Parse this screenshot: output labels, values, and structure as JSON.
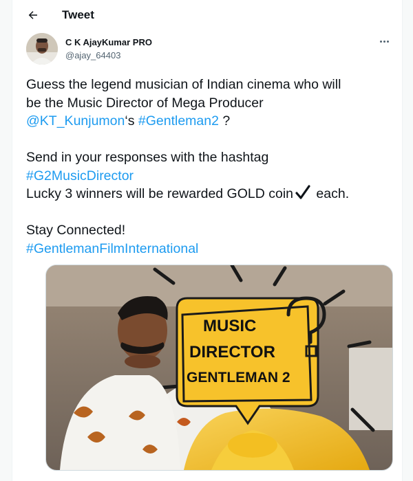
{
  "header": {
    "title": "Tweet",
    "back_icon": "arrow-left-icon"
  },
  "author": {
    "name": "C K AjayKumar PRO",
    "handle": "@ajay_64403",
    "more_icon": "more-horizontal-icon"
  },
  "tweet": {
    "line1": "Guess the legend musician of Indian cinema who will",
    "line2": "be the Music Director of Mega Producer",
    "mention": "@KT_Kunjumon",
    "possessive": "‘s ",
    "hashtag_gentleman2": "#Gentleman2",
    "question_mark": " ?",
    "line4": "Send in your responses with the hashtag",
    "hashtag_g2": "#G2MusicDirector",
    "line6_pre": "Lucky 3 winners will be rewarded GOLD coin",
    "line6_post": " each.",
    "line8": "Stay Connected!",
    "hashtag_international": "#GentlemanFilmInternational"
  },
  "media": {
    "badge_line1": "MUSIC",
    "badge_line2": "DIRECTOR",
    "badge_line3": "GENTLEMAN 2"
  },
  "colors": {
    "link": "#1d9bf0",
    "text": "#0f1419",
    "secondary": "#536471",
    "badge_yellow": "#f7c22b"
  }
}
